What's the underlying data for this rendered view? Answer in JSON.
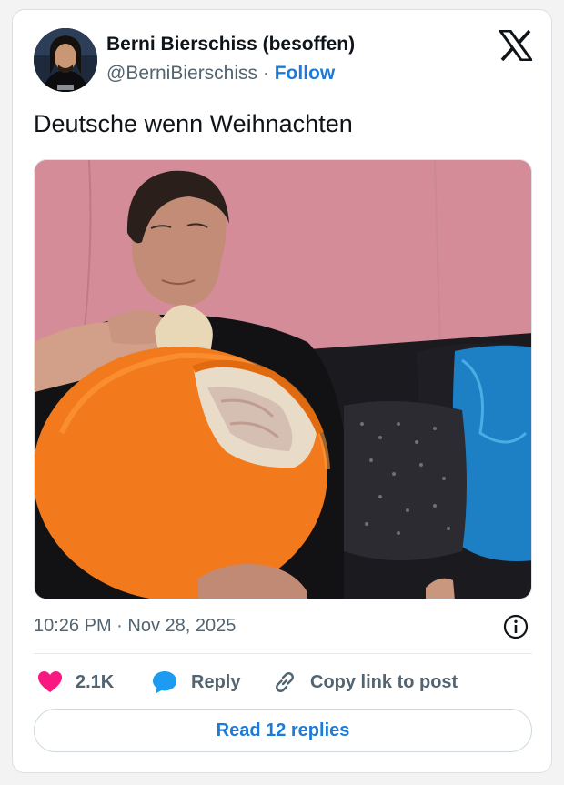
{
  "author": {
    "display_name": "Berni Bierschiss (besoffen)",
    "handle": "@BerniBierschiss",
    "separator": "·",
    "follow_label": "Follow",
    "avatar_icon": "avatar-photo"
  },
  "tweet": {
    "text": "Deutsche wenn Weihnachten",
    "timestamp": "10:26 PM · Nov 28, 2025"
  },
  "actions": {
    "like_count": "2.1K",
    "reply_label": "Reply",
    "copy_label": "Copy link to post",
    "read_replies_label": "Read 12 replies"
  },
  "colors": {
    "link_blue": "#1d7bd8",
    "like_pink": "#f91880",
    "reply_blue": "#1d9bf0",
    "text_dark": "#0f1419",
    "text_gray": "#536471"
  }
}
